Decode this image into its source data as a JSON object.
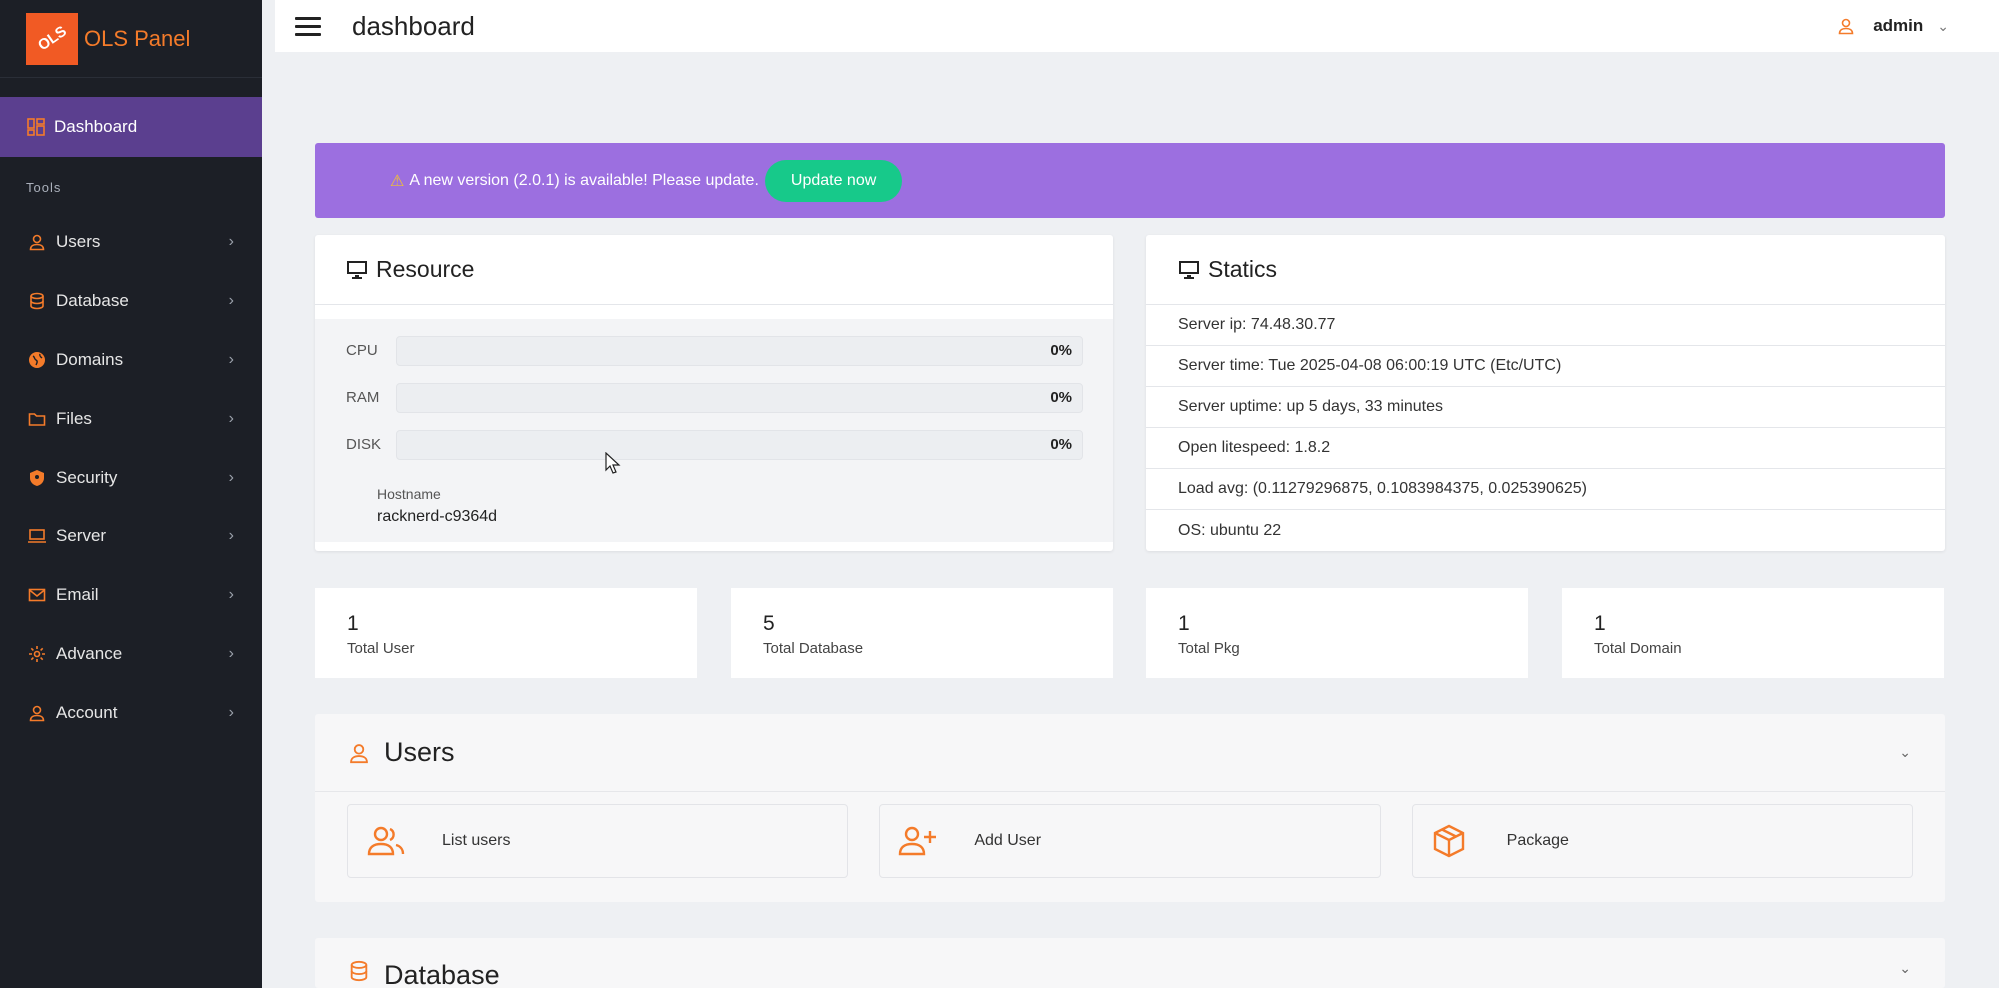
{
  "brand": {
    "logo_text": "OLS",
    "name": "OLS Panel"
  },
  "sidebar": {
    "active": "Dashboard",
    "section_label": "Tools",
    "items": [
      {
        "label": "Users",
        "icon": "user-icon"
      },
      {
        "label": "Database",
        "icon": "database-icon"
      },
      {
        "label": "Domains",
        "icon": "globe-icon"
      },
      {
        "label": "Files",
        "icon": "folder-icon"
      },
      {
        "label": "Security",
        "icon": "shield-icon"
      },
      {
        "label": "Server",
        "icon": "laptop-icon"
      },
      {
        "label": "Email",
        "icon": "mail-icon"
      },
      {
        "label": "Advance",
        "icon": "gear-icon"
      },
      {
        "label": "Account",
        "icon": "user-icon"
      }
    ]
  },
  "header": {
    "title": "dashboard",
    "user": "admin"
  },
  "banner": {
    "message": "A new version (2.0.1) is available! Please update.",
    "button": "Update now"
  },
  "resource": {
    "title": "Resource",
    "rows": [
      {
        "label": "CPU",
        "value": "0%"
      },
      {
        "label": "RAM",
        "value": "0%"
      },
      {
        "label": "DISK",
        "value": "0%"
      }
    ],
    "hostname_label": "Hostname",
    "hostname": "racknerd-c9364d"
  },
  "statics": {
    "title": "Statics",
    "rows": [
      "Server ip: 74.48.30.77",
      "Server time: Tue 2025-04-08 06:00:19 UTC (Etc/UTC)",
      "Server uptime: up 5 days, 33 minutes",
      "Open litespeed: 1.8.2",
      "Load avg: (0.11279296875, 0.1083984375, 0.025390625)",
      "OS: ubuntu 22"
    ]
  },
  "summary": [
    {
      "num": "1",
      "label": "Total User"
    },
    {
      "num": "5",
      "label": "Total Database"
    },
    {
      "num": "1",
      "label": "Total Pkg"
    },
    {
      "num": "1",
      "label": "Total Domain"
    }
  ],
  "users_section": {
    "title": "Users",
    "actions": [
      {
        "label": "List users",
        "icon": "users-icon"
      },
      {
        "label": "Add User",
        "icon": "add-user-icon"
      },
      {
        "label": "Package",
        "icon": "package-icon"
      }
    ]
  },
  "database_section": {
    "title": "Database"
  },
  "colors": {
    "accent": "#f47b2a",
    "sidebar_bg": "#1c1f26",
    "active_bg": "#5b3f8f",
    "banner_bg": "#9c6fe0",
    "button_green": "#17c98a"
  }
}
